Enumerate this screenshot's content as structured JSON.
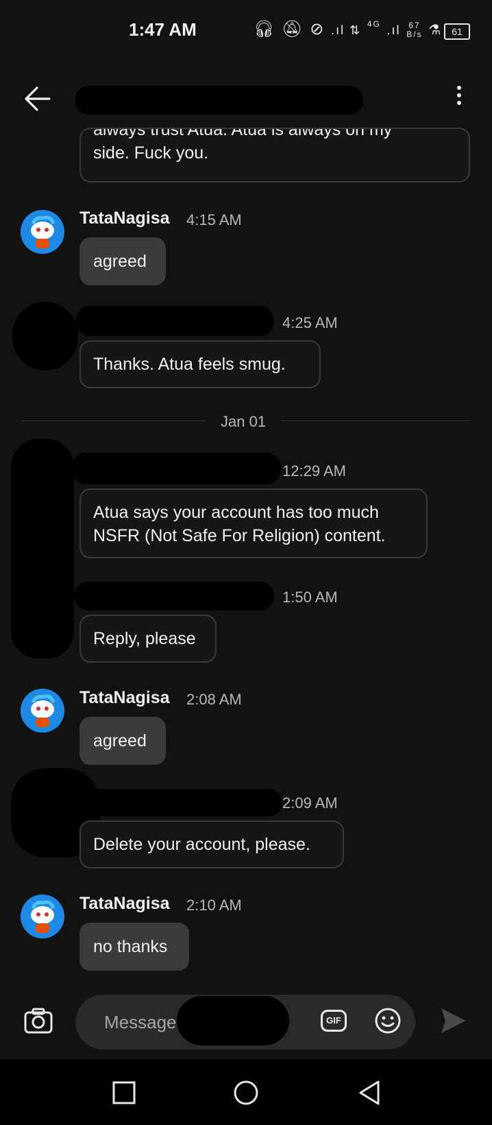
{
  "status_bar": {
    "time": "1:47 AM",
    "net_speed_value": "67",
    "net_speed_unit": "B/s",
    "network": "4G",
    "battery": "61"
  },
  "header": {
    "back_icon": "arrow-left-icon",
    "menu_icon": "vertical-ellipsis-icon"
  },
  "messages": [
    {
      "text_line1": "always trust Atua. Atua is always on my",
      "text_line2": "side. Fuck you."
    },
    {
      "sender": "TataNagisa",
      "time": "4:15 AM",
      "text": "agreed"
    },
    {
      "time": "4:25 AM",
      "text": "Thanks. Atua feels smug."
    },
    {
      "date_divider": "Jan 01"
    },
    {
      "time": "12:29 AM",
      "text_line1": "Atua says your account has too much",
      "text_line2": "NSFR (Not Safe For Religion) content."
    },
    {
      "time": "1:50 AM",
      "text": "Reply, please"
    },
    {
      "sender": "TataNagisa",
      "time": "2:08 AM",
      "text": "agreed"
    },
    {
      "time": "2:09 AM",
      "text": "Delete your account, please."
    },
    {
      "sender": "TataNagisa",
      "time": "2:10 AM",
      "text": "no thanks"
    }
  ],
  "composer": {
    "placeholder": "Message",
    "gif_label": "GIF",
    "camera_icon": "camera-icon",
    "emoji_icon": "emoji-icon",
    "send_icon": "send-icon"
  },
  "colors": {
    "background": "#121212",
    "bubble_outline": "#3a3a3a",
    "bubble_filled": "#3b3b3b",
    "avatar_blue": "#1e88e5"
  }
}
